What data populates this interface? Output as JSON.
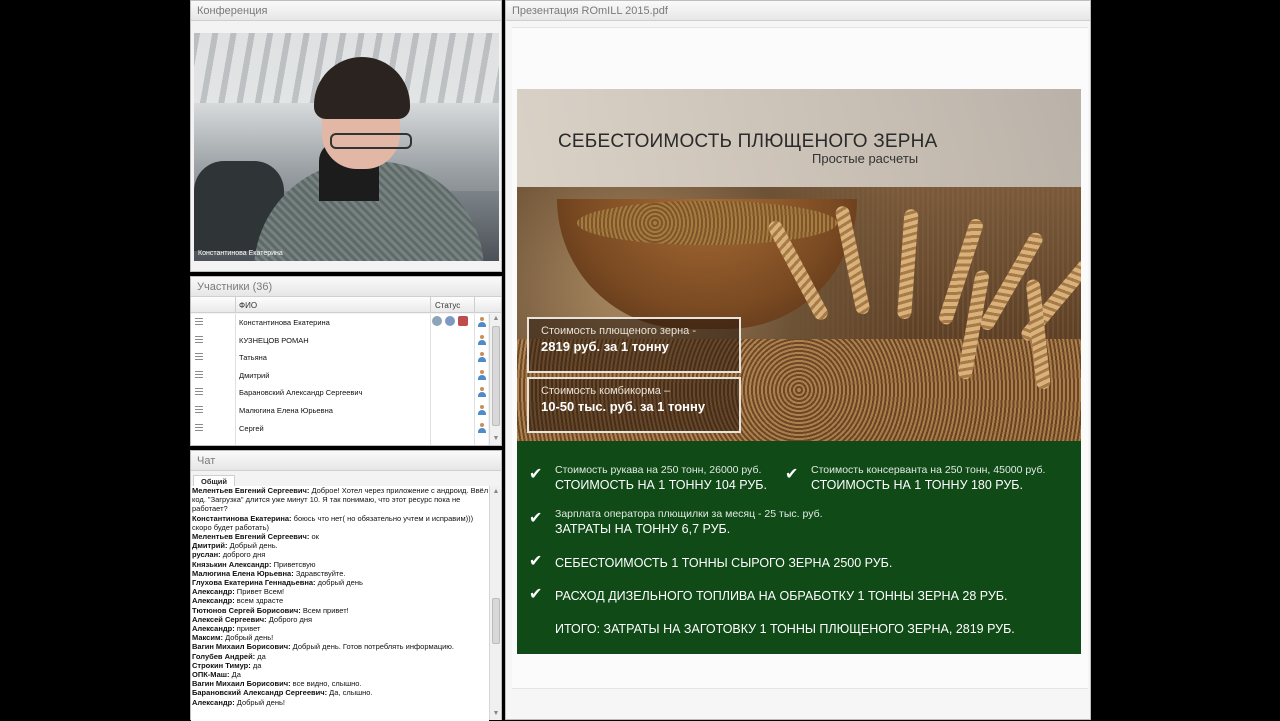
{
  "conference": {
    "title": "Конференция",
    "video_caption": "Константинова Екатерина"
  },
  "participants": {
    "title": "Участники (36)",
    "columns": {
      "fio": "ФИО",
      "status": "Статус"
    },
    "rows": [
      "Константинова Екатерина",
      "КУЗНЕЦОВ РОМАН",
      "Татьяна",
      "Дмитрий",
      "Барановский Александр  Сергеевич",
      "Малюгина Елена  Юрьевна",
      "Сергей"
    ]
  },
  "chat": {
    "title": "Чат",
    "tab": "Общий",
    "messages": [
      {
        "author": "Мелентьев Евгений  Сергеевич:",
        "text": " Доброе! Хотел через приложение с андроид. Ввёл код. \"Загрузка\" длится уже минут 10. Я так понимаю, что этот ресурс пока не работает?"
      },
      {
        "author": "Константинова Екатерина:",
        "text": " боюсь что нет( но обязательно учтем и исправим))) скоро будет работать)"
      },
      {
        "author": "Мелентьев Евгений  Сергеевич:",
        "text": " ок"
      },
      {
        "author": "Дмитрий:",
        "text": " Добрый день."
      },
      {
        "author": "руслан:",
        "text": " доброго дня"
      },
      {
        "author": "Князькин  Александр:",
        "text": " Приветсвую"
      },
      {
        "author": "Малюгина Елена  Юрьевна:",
        "text": " Здравствуйте."
      },
      {
        "author": "Глухова Екатерина Геннадьевна:",
        "text": " добрый день"
      },
      {
        "author": "Александр:",
        "text": " Привет Всем!"
      },
      {
        "author": "Александр:",
        "text": " всем здрасте"
      },
      {
        "author": "Тютюнов Сергей  Борисович:",
        "text": " Всем привет!"
      },
      {
        "author": "Алексей  Сергеевич:",
        "text": " Доброго дня"
      },
      {
        "author": "Александр:",
        "text": " привет"
      },
      {
        "author": "Максим:",
        "text": " Добрый день!"
      },
      {
        "author": "Вагин Михаил  Борисович:",
        "text": " Добрый день. Готов потреблять информацию."
      },
      {
        "author": "Голубев  Андрей:",
        "text": " да"
      },
      {
        "author": "Строкин Тимур:",
        "text": " да"
      },
      {
        "author": "ОПК-Маш:",
        "text": " Да"
      },
      {
        "author": "Вагин Михаил  Борисович:",
        "text": " все видно, слышно."
      },
      {
        "author": "Барановский Александр  Сергеевич:",
        "text": " Да, слышно."
      },
      {
        "author": "Александр:",
        "text": " Добрый день!"
      }
    ]
  },
  "presentation": {
    "title": "Презентация ROmILL 2015.pdf",
    "slide": {
      "title": "СЕБЕСТОИМОСТЬ ПЛЮЩЕНОГО ЗЕРНА",
      "subtitle": "Простые расчеты",
      "box1": {
        "small": "Стоимость плющеного зерна -",
        "big": "2819 руб. за 1 тонну"
      },
      "box2": {
        "small": "Стоимость комбикорма –",
        "big": "10-50 тыс. руб. за 1 тонну"
      },
      "items": [
        {
          "t1": "Стоимость рукава на 250 тонн, 26000 руб.",
          "t2": "СТОИМОСТЬ НА 1 ТОННУ 104 РУБ."
        },
        {
          "t1": "Стоимость консерванта на 250 тонн, 45000 руб.",
          "t2": "СТОИМОСТЬ НА 1 ТОННУ 180 РУБ."
        },
        {
          "t1": "Зарплата оператора плющилки за месяц - 25 тыс. руб.",
          "t2": "ЗАТРАТЫ НА ТОННУ 6,7 РУБ."
        },
        {
          "t2": "СЕБЕСТОИМОСТЬ 1 ТОННЫ СЫРОГО ЗЕРНА 2500 РУБ."
        },
        {
          "t2": "РАСХОД ДИЗЕЛЬНОГО ТОПЛИВА НА ОБРАБОТКУ 1 ТОННЫ ЗЕРНА 28 РУБ."
        }
      ],
      "total": "ИТОГО: ЗАТРАТЫ НА ЗАГОТОВКУ 1 ТОННЫ ПЛЮЩЕНОГО ЗЕРНА, 2819 РУБ."
    }
  },
  "icons": {
    "check": "✔",
    "scroll_up": "▲",
    "scroll_down": "▼"
  }
}
